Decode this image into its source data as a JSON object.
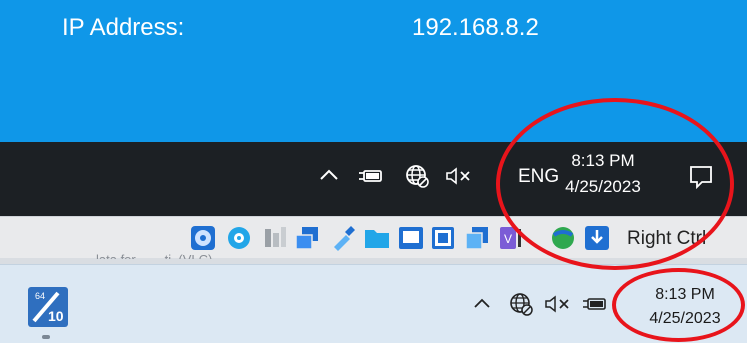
{
  "vm_desktop": {
    "ip_label": "IP Address:",
    "ip_value": "192.168.8.2"
  },
  "vm_taskbar": {
    "language": "ENG",
    "time": "8:13 PM",
    "date": "4/25/2023",
    "tray_icons": [
      "chevron-up-icon",
      "battery-plug-icon",
      "network-globe-icon",
      "volume-muted-icon",
      "notification-icon"
    ]
  },
  "vbox_statusbar": {
    "host_key_label": "Right Ctrl",
    "icons": [
      "hard-disk-icon",
      "optical-drive-icon",
      "audio-icon",
      "network-adapters-icon",
      "usb-icon",
      "shared-folders-icon",
      "display-icon",
      "recording-icon",
      "cpu-vt-icon",
      "mouse-integration-icon",
      "keyboard-capture-icon"
    ],
    "background_text": "lata for ... ...ti..(VLC)"
  },
  "host_taskbar": {
    "app_badge": "64",
    "app_number": "10",
    "time": "8:13 PM",
    "date": "4/25/2023",
    "tray_icons": [
      "chevron-up-icon",
      "network-globe-icon",
      "volume-muted-icon",
      "battery-plug-icon"
    ]
  },
  "annotations": {
    "color": "#e8141b"
  },
  "colors": {
    "vm_desktop": "#0f97e8",
    "vm_taskbar": "#1c2024",
    "host_taskbar": "#dce8f3"
  }
}
